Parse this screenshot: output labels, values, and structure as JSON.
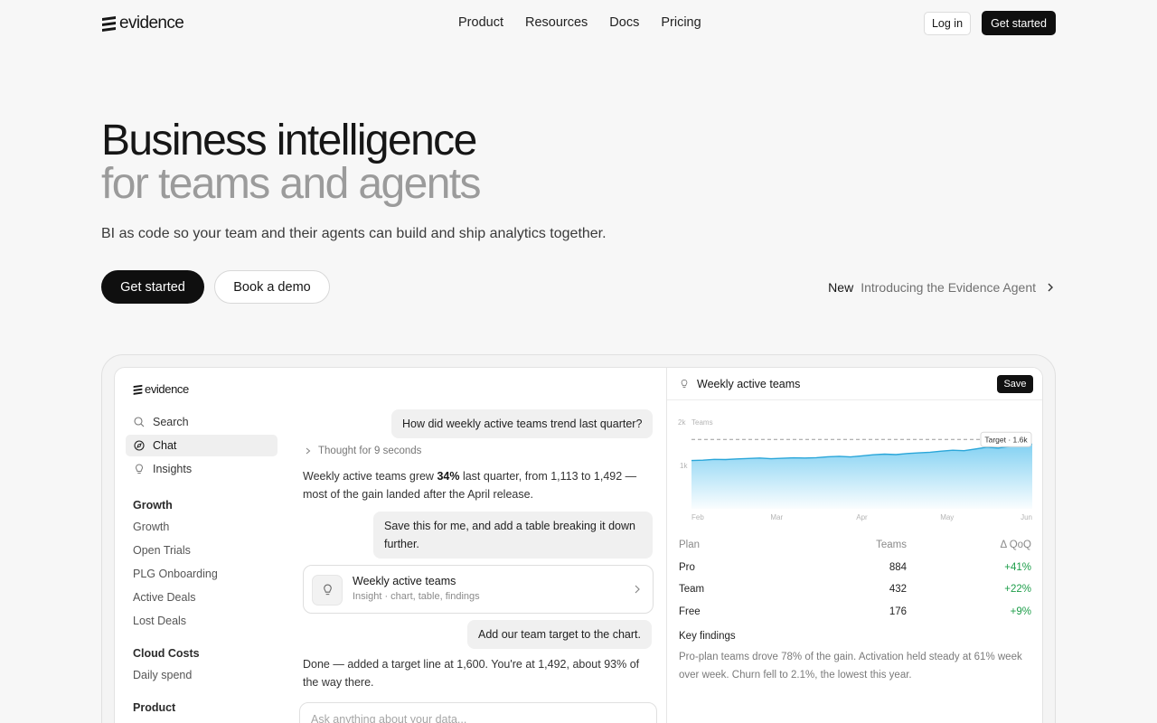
{
  "nav": {
    "brand": "evidence",
    "links": [
      "Product",
      "Resources",
      "Docs",
      "Pricing"
    ],
    "login": "Log in",
    "get_started": "Get started"
  },
  "hero": {
    "title_line1": "Business intelligence",
    "title_line2": "for teams and agents",
    "subtitle": "BI as code so your team and their agents can build and ship analytics together.",
    "primary_cta": "Get started",
    "secondary_cta": "Book a demo",
    "announcement_tag": "New",
    "announcement_text": "Introducing the Evidence Agent"
  },
  "app": {
    "brand": "evidence",
    "sidebar": {
      "top_items": [
        {
          "label": "Search",
          "icon": "search-icon"
        },
        {
          "label": "Chat",
          "icon": "chat-icon",
          "active": true
        },
        {
          "label": "Insights",
          "icon": "lightbulb-icon"
        }
      ],
      "sections": [
        {
          "title": "Growth",
          "items": [
            "Growth",
            "Open Trials",
            "PLG Onboarding",
            "Active Deals",
            "Lost Deals"
          ]
        },
        {
          "title": "Cloud Costs",
          "items": [
            "Daily spend"
          ]
        },
        {
          "title": "Product",
          "items": []
        }
      ]
    },
    "chat": {
      "q1": "How did weekly active teams trend last quarter?",
      "thought": "Thought for 9 seconds",
      "a1_pre": "Weekly active teams grew ",
      "a1_bold": "34%",
      "a1_post": " last quarter, from 1,113 to 1,492 — most of the gain landed after the April release.",
      "q2": "Save this for me, and add a table breaking it down further.",
      "card_title": "Weekly active teams",
      "card_subtitle": "Insight · chart, table, findings",
      "q3": "Add our team target to the chart.",
      "a3": "Done — added a target line at 1,600. You're at 1,492, about 93% of the way there.",
      "input_placeholder": "Ask anything about your data..."
    },
    "panel": {
      "title": "Weekly active teams",
      "save": "Save",
      "findings_title": "Key findings",
      "findings": "Pro-plan teams drove 78% of the gain. Activation held steady at 61% week over week. Churn fell to 2.1%, the lowest this year.",
      "table": {
        "headers": [
          "Plan",
          "Teams",
          "Δ QoQ"
        ],
        "rows": [
          [
            "Pro",
            "884",
            "+41%"
          ],
          [
            "Team",
            "432",
            "+22%"
          ],
          [
            "Free",
            "176",
            "+9%"
          ]
        ]
      }
    }
  },
  "chart_data": {
    "type": "area",
    "ylabel": "Teams",
    "ylim": [
      0,
      2000
    ],
    "y_ticks": [
      "1k",
      "2k"
    ],
    "x_ticks": [
      "Feb",
      "Mar",
      "Apr",
      "May",
      "Jun"
    ],
    "target_label": "Target · 1.6k",
    "target": 1600,
    "series": [
      {
        "values": [
          1113,
          1120,
          1140,
          1135,
          1150,
          1160,
          1170,
          1155,
          1165,
          1175,
          1170,
          1180,
          1200,
          1210,
          1195,
          1220,
          1245,
          1260,
          1250,
          1275,
          1290,
          1305,
          1330,
          1350,
          1340,
          1380,
          1420,
          1400,
          1440,
          1460,
          1492
        ]
      }
    ],
    "accent": "#2aa6d9"
  }
}
